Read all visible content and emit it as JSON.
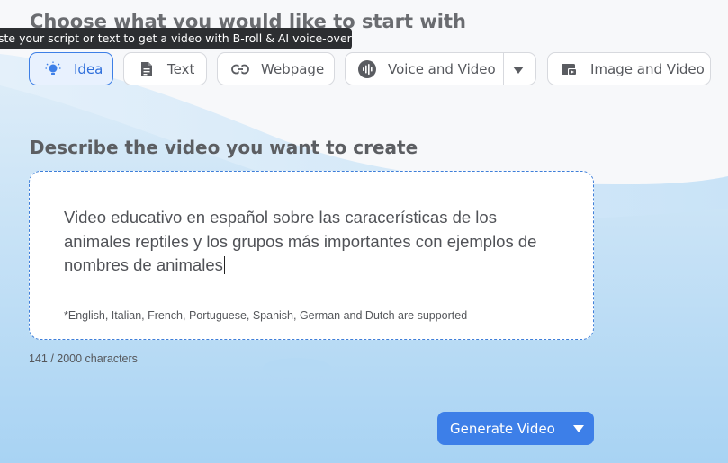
{
  "header": {
    "title": "Choose what you would like to start with",
    "tooltip": "ste your script or text to get a video with B-roll & AI voice-over"
  },
  "options": [
    {
      "label": "Idea",
      "icon": "lightbulb-icon",
      "active": true
    },
    {
      "label": "Text",
      "icon": "document-icon",
      "active": false
    },
    {
      "label": "Webpage",
      "icon": "link-icon",
      "active": false
    },
    {
      "label": "Voice and Video",
      "icon": "voice-wave-icon",
      "active": false
    },
    {
      "label": "Image and Video",
      "icon": "image-video-icon",
      "active": false
    }
  ],
  "prompt": {
    "title": "Describe the video you want to create",
    "value": "Video educativo en español sobre las caracerísticas de los animales reptiles y los grupos más importantes con ejemplos de nombres de animales",
    "supported_note": "*English, Italian, French, Portuguese, Spanish, German and Dutch are supported",
    "counter": "141 / 2000 characters"
  },
  "actions": {
    "generate_label": "Generate Video"
  },
  "colors": {
    "accent": "#3d7fe8",
    "active_bg": "#e8f1fe",
    "tooltip_bg": "#2c2e31"
  }
}
